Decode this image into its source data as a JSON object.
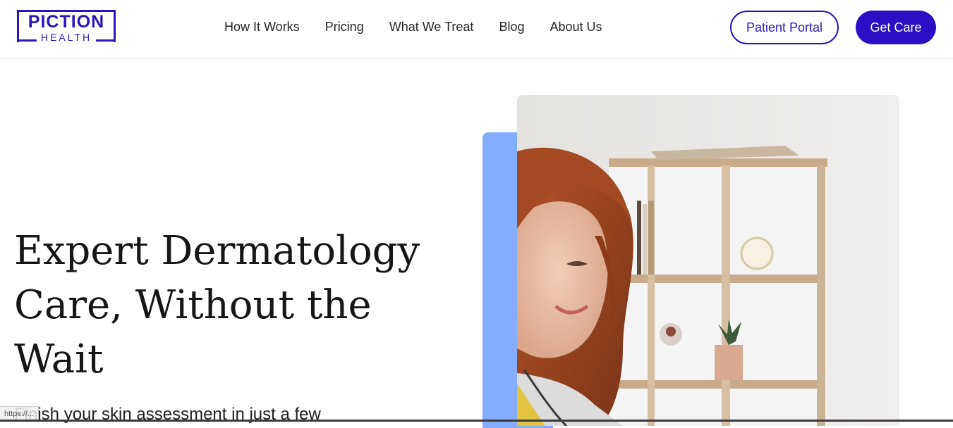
{
  "brand": {
    "logo_top": "PICTION",
    "logo_bottom": "HEALTH",
    "accent_color": "#2a17b8"
  },
  "nav": {
    "items": [
      "How It Works",
      "Pricing",
      "What We Treat",
      "Blog",
      "About Us"
    ]
  },
  "actions": {
    "portal_label": "Patient Portal",
    "care_label": "Get Care"
  },
  "hero": {
    "title": "Expert Dermatology Care, Without the Wait",
    "subtitle": "Finish your skin assessment in just a few",
    "image_icon": "woman-smiling-photo"
  },
  "status_bar": {
    "url": "https://..."
  }
}
